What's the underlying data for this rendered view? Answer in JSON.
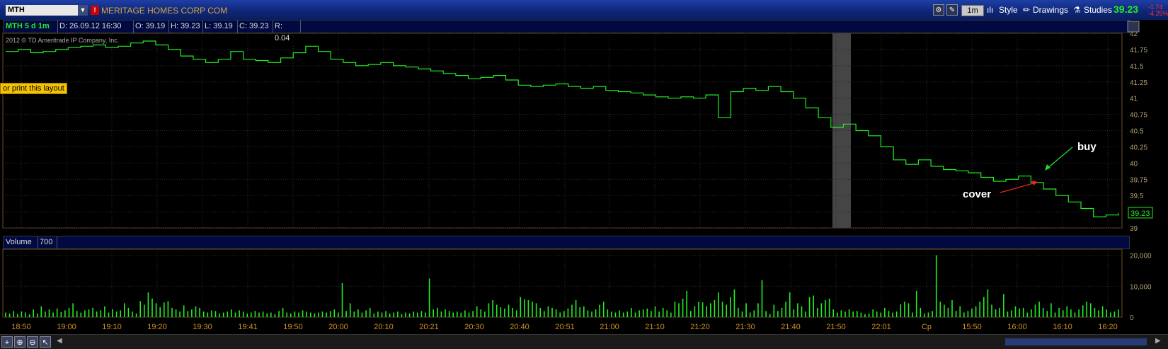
{
  "header": {
    "symbol": "MTH",
    "company": "MERITAGE HOMES CORP COM",
    "timeframe_btn": "1m",
    "style_label": "Style",
    "drawings_label": "Drawings",
    "studies_label": "Studies",
    "last_price": "39.23",
    "change": "-1.74",
    "change_pct": "-4.25%"
  },
  "info": {
    "label": "MTH 5 d 1m",
    "date": "D: 26.09.12 16:30",
    "open": "O: 39.19",
    "high": "H: 39.23",
    "low": "L: 39.19",
    "close": "C: 39.23",
    "range": "R: 0.04"
  },
  "copyright": "2012 © TD Ameritrade IP Company, Inc.",
  "tooltip": "or print this layout",
  "volume_label": "Volume",
  "volume_value": "700",
  "annotations": {
    "buy": "buy",
    "cover": "cover"
  },
  "colors": {
    "price_line": "#22ee22",
    "grid": "#2a2a2a",
    "axis_text": "#b0a070",
    "time_text": "#d09020",
    "buy_arrow": "#22dd22",
    "cover_arrow": "#ee2222"
  },
  "chart_data": [
    {
      "type": "line",
      "series": [
        {
          "values": [
            41.72,
            41.75,
            41.7,
            41.72,
            41.75,
            41.78,
            41.8,
            41.82,
            41.78,
            41.8,
            41.85,
            41.88,
            41.82,
            41.75,
            41.65,
            41.6,
            41.55,
            41.6,
            41.72,
            41.6,
            41.58,
            41.55,
            41.62,
            41.7,
            41.8,
            41.72,
            41.6,
            41.55,
            41.5,
            41.52,
            41.55,
            41.5,
            41.48,
            41.45,
            41.42,
            41.38,
            41.35,
            41.3,
            41.32,
            41.35,
            41.28,
            41.2,
            41.18,
            41.2,
            41.22,
            41.18,
            41.15,
            41.18,
            41.12,
            41.1,
            41.08,
            41.05,
            41.02,
            41.0,
            41.02,
            41.0,
            41.05,
            40.7,
            41.1,
            41.15,
            41.12,
            41.18,
            41.1,
            41.0,
            40.85,
            40.7,
            40.55,
            40.6,
            40.5,
            40.42,
            40.25,
            40.05,
            39.98,
            40.05,
            39.95,
            39.9,
            39.88,
            39.85,
            39.78,
            39.72,
            39.75,
            39.8,
            39.7,
            39.6,
            39.5,
            39.4,
            39.3,
            39.17,
            39.2,
            39.23
          ]
        }
      ],
      "ylim": [
        39,
        42
      ],
      "yticks": [
        "42",
        "41.75",
        "41.5",
        "41.25",
        "41",
        "40.75",
        "40.5",
        "40.25",
        "40",
        "39.75",
        "39.5",
        "39.25",
        "39"
      ],
      "price_label": "39.23",
      "grid": true
    },
    {
      "type": "bar",
      "title": "Volume",
      "yticks": [
        "20,000",
        "10,000",
        "0"
      ],
      "ylim": [
        0,
        22000
      ],
      "xticks": [
        "18:50",
        "19:00",
        "19:10",
        "19:20",
        "19:30",
        "19:41",
        "19:50",
        "20:00",
        "20:10",
        "20:21",
        "20:30",
        "20:40",
        "20:51",
        "21:00",
        "21:10",
        "21:20",
        "21:30",
        "21:40",
        "21:50",
        "22:01",
        "Cp",
        "15:50",
        "16:00",
        "16:10",
        "16:20"
      ],
      "values": [
        1500,
        1200,
        2000,
        1000,
        1800,
        1500,
        900,
        2500,
        1200,
        3500,
        1800,
        2500,
        1500,
        2800,
        1600,
        2200,
        3000,
        4500,
        2000,
        1500,
        2200,
        2500,
        3000,
        1800,
        2200,
        3500,
        1500,
        2600,
        1800,
        2200,
        4500,
        3000,
        1800,
        1200,
        5200,
        4000,
        8000,
        6000,
        4500,
        3200,
        4800,
        5200,
        3000,
        2500,
        1800,
        3800,
        2000,
        2500,
        3500,
        3000,
        1800,
        1500,
        2200,
        2000,
        1200,
        1500,
        1800,
        2500,
        1500,
        2200,
        1800,
        1200,
        1500,
        2000,
        1500,
        1800,
        1200,
        1500,
        1000,
        2000,
        3000,
        1500,
        1200,
        1800,
        1500,
        2200,
        1800,
        1500,
        1200,
        1500,
        1800,
        1500,
        2000,
        2500,
        1500,
        11000,
        2000,
        4500,
        1800,
        2500,
        1500,
        2200,
        3000,
        1200,
        1800,
        1500,
        2000,
        1200,
        1500,
        1800,
        1000,
        1500,
        1200,
        1800,
        1500,
        2000,
        1500,
        12500,
        2500,
        3000,
        1800,
        2500,
        2000,
        1500,
        1800,
        1500,
        2200,
        1500,
        2000,
        3500,
        2500,
        1800,
        4500,
        5500,
        4000,
        3200,
        2800,
        4000,
        3000,
        2200,
        6500,
        5800,
        5500,
        5000,
        4500,
        3000,
        2000,
        3500,
        3000,
        2500,
        1500,
        2000,
        2800,
        4000,
        5500,
        3200,
        3500,
        2200,
        1800,
        2500,
        4000,
        5000,
        2500,
        1800,
        1500,
        2200,
        1500,
        1800,
        3000,
        1500,
        2200,
        2500,
        2800,
        2000,
        3500,
        1800,
        3000,
        2200,
        1500,
        5000,
        4500,
        6000,
        8500,
        2000,
        3500,
        5000,
        4800,
        3500,
        4500,
        5500,
        8000,
        5000,
        4000,
        6500,
        9000,
        3000,
        1800,
        4500,
        1500,
        2200,
        4500,
        12000,
        2000,
        1000,
        4000,
        2000,
        3000,
        5000,
        8000,
        2500,
        4500,
        3500,
        1800,
        6500,
        7000,
        3000,
        4500,
        5500,
        6000,
        2500,
        1500,
        2200,
        1800,
        2500,
        1800,
        2000,
        1500,
        1000,
        1200,
        2500,
        1800,
        1500,
        3000,
        2000,
        1500,
        1800,
        4200,
        5000,
        4500,
        1500,
        8500,
        3000,
        1200,
        1500,
        2000,
        20000,
        5000,
        4000,
        3000,
        5500,
        2000,
        3500,
        1500,
        2000,
        2800,
        3500,
        5000,
        6500,
        9000,
        4000,
        2500,
        3000,
        7500,
        1800,
        2200,
        3500,
        2800,
        3000,
        1500,
        2500,
        4000,
        5000,
        3000,
        2000,
        4500,
        1500,
        3000,
        2200,
        3500,
        2500,
        1500,
        2500,
        3800,
        5000,
        4500,
        3000,
        2200,
        3500,
        2500,
        1500,
        1800,
        2500
      ]
    }
  ]
}
